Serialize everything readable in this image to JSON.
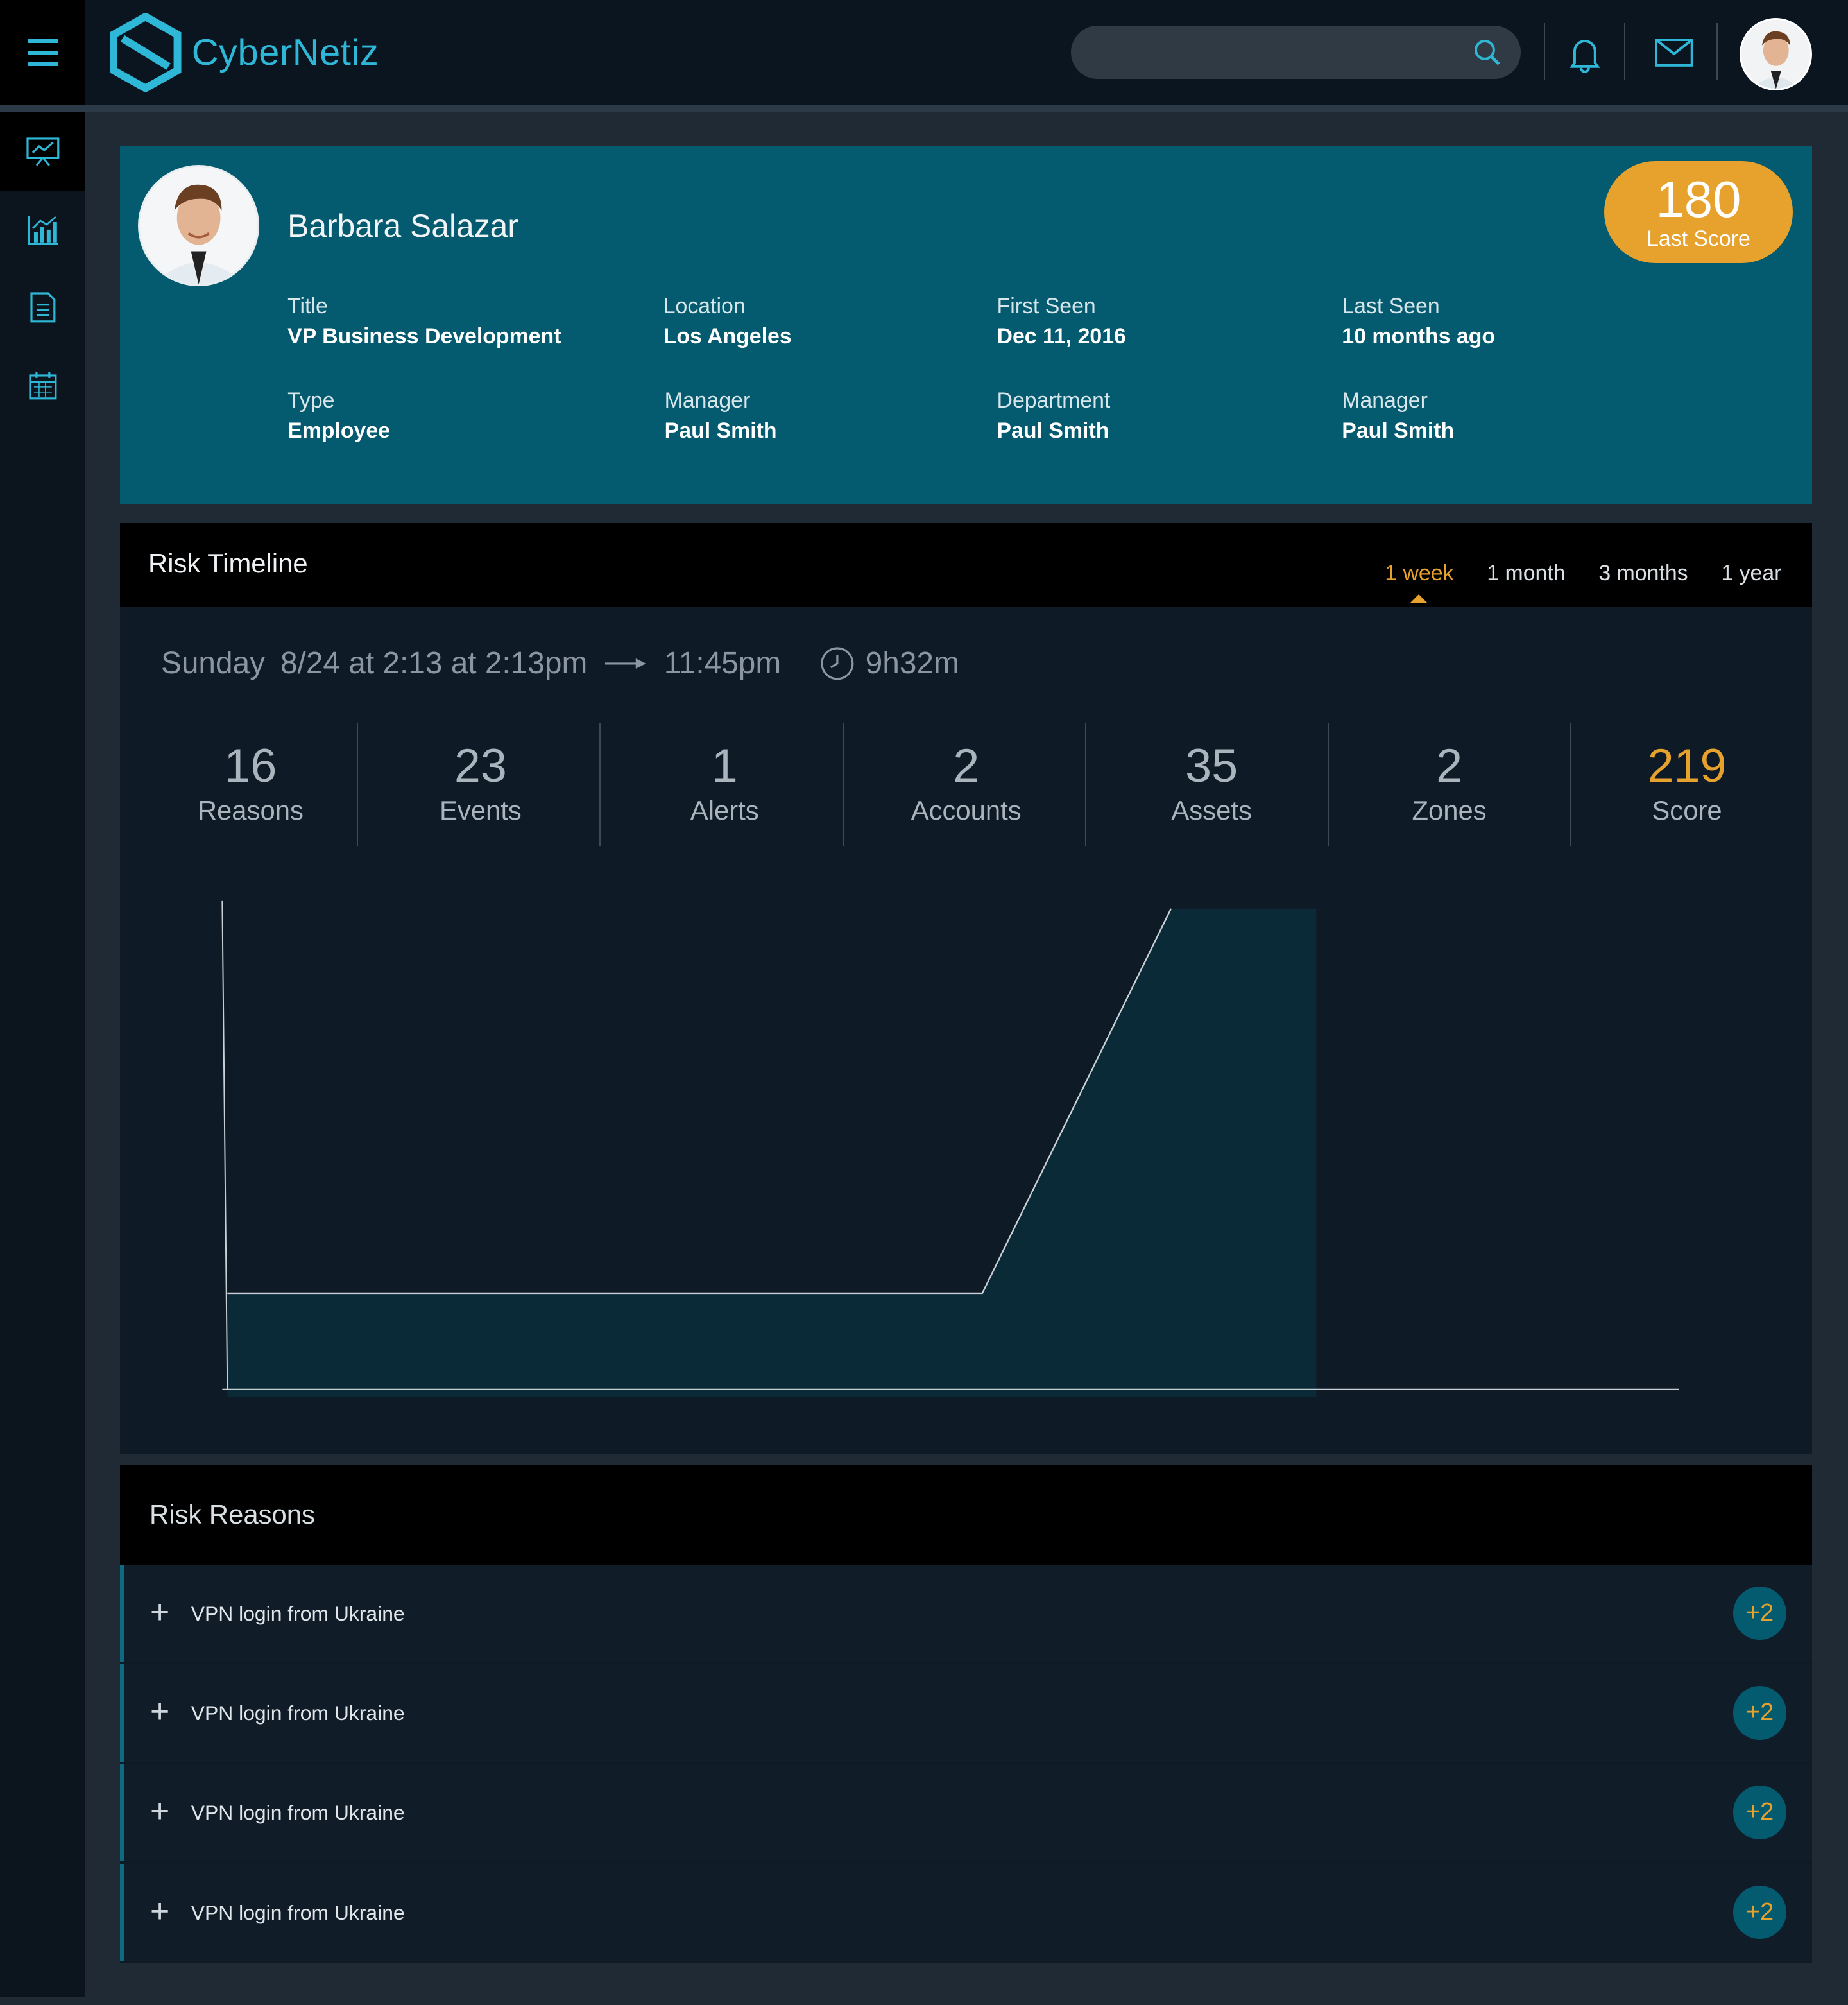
{
  "brand": {
    "name": "CyberNetiz",
    "accent": "#2eb7d6",
    "highlight": "#e6a22c"
  },
  "header": {
    "menu_icon": "hamburger-icon",
    "search_placeholder": "",
    "icons": [
      "search-icon",
      "bell-icon",
      "mail-icon"
    ]
  },
  "sidebar": {
    "items": [
      {
        "icon": "presentation-chart-icon",
        "active": true
      },
      {
        "icon": "bar-chart-icon",
        "active": false
      },
      {
        "icon": "document-list-icon",
        "active": false
      },
      {
        "icon": "calendar-icon",
        "active": false
      }
    ]
  },
  "profile": {
    "name": "Barbara Salazar",
    "last_score": "180",
    "last_score_label": "Last Score",
    "fields": [
      {
        "label": "Title",
        "value": "VP Business Development"
      },
      {
        "label": "Location",
        "value": "Los Angeles"
      },
      {
        "label": "First Seen",
        "value": "Dec 11, 2016"
      },
      {
        "label": "Last Seen",
        "value": "10 months ago"
      },
      {
        "label": "Type",
        "value": "Employee"
      },
      {
        "label": "Manager",
        "value": "Paul Smith"
      },
      {
        "label": "Department",
        "value": "Paul Smith"
      },
      {
        "label": "Manager",
        "value": "Paul Smith"
      }
    ]
  },
  "timeline": {
    "title": "Risk Timeline",
    "tabs": [
      {
        "label": "1 week",
        "active": true
      },
      {
        "label": "1 month",
        "active": false
      },
      {
        "label": "3 months",
        "active": false
      },
      {
        "label": "1 year",
        "active": false
      }
    ],
    "range": {
      "day": "Sunday",
      "start": "8/24 at 2:13 at 2:13pm",
      "end": "11:45pm",
      "duration": "9h32m"
    },
    "stats": [
      {
        "value": "16",
        "label": "Reasons"
      },
      {
        "value": "23",
        "label": "Events"
      },
      {
        "value": "1",
        "label": "Alerts"
      },
      {
        "value": "2",
        "label": "Accounts"
      },
      {
        "value": "35",
        "label": "Assets"
      },
      {
        "value": "2",
        "label": "Zones"
      },
      {
        "value": "219",
        "label": "Score"
      }
    ]
  },
  "chart_data": {
    "type": "area",
    "title": "",
    "xlabel": "",
    "ylabel": "",
    "x": [
      0,
      52,
      65,
      75
    ],
    "values": [
      20,
      20,
      100,
      100
    ],
    "xlim": [
      0,
      100
    ],
    "ylim": [
      0,
      100
    ],
    "grid": false,
    "line_color": "#c8d0d6",
    "fill_color": "#0b2a38"
  },
  "reasons": {
    "title": "Risk Reasons",
    "items": [
      {
        "text": "VPN login from Ukraine",
        "badge": "+2"
      },
      {
        "text": "VPN login from Ukraine",
        "badge": "+2"
      },
      {
        "text": "VPN login from Ukraine",
        "badge": "+2"
      },
      {
        "text": "VPN login from Ukraine",
        "badge": "+2"
      }
    ]
  }
}
